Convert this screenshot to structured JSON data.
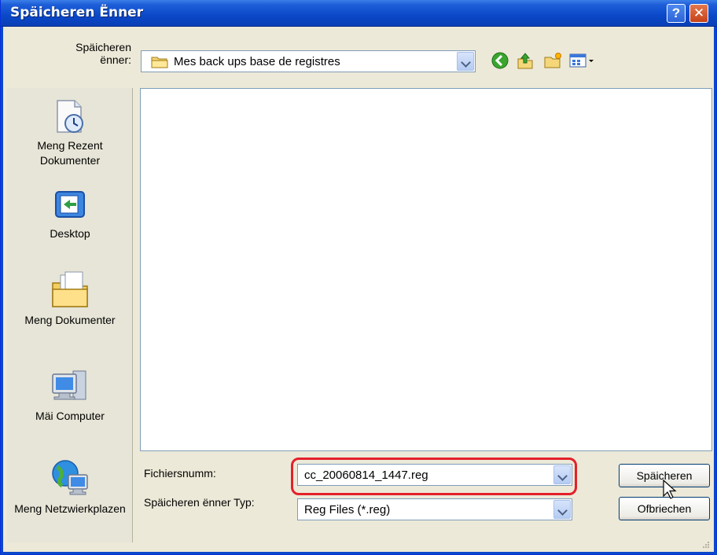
{
  "window": {
    "title": "Späicheren Ënner"
  },
  "titlebar_buttons": {
    "help_label": "?",
    "close_label": "✕"
  },
  "toolbar": {
    "save_in_label": "Späicheren ënner:",
    "save_in_value": "Mes back ups base de registres",
    "icons": [
      "back-icon",
      "up-folder-icon",
      "new-folder-icon",
      "view-menu-icon"
    ]
  },
  "places": [
    {
      "label": "Meng Rezent Dokumenter",
      "icon": "recent-documents-icon"
    },
    {
      "label": "Desktop",
      "icon": "desktop-icon"
    },
    {
      "label": "Meng Dokumenter",
      "icon": "my-documents-icon"
    },
    {
      "label": "Mäi Computer",
      "icon": "my-computer-icon"
    },
    {
      "label": "Meng Netzwierkplazen",
      "icon": "network-places-icon"
    }
  ],
  "file_list": {
    "items": []
  },
  "filename": {
    "label": "Fichiersnumm:",
    "value": "cc_20060814_1447.reg"
  },
  "filetype": {
    "label": "Späicheren ënner Typ:",
    "value": "Reg Files (*.reg)"
  },
  "buttons": {
    "save": "Späicheren",
    "cancel": "Ofbriechen"
  },
  "colors": {
    "titlebar": "#0a48c8",
    "dialog_bg": "#ece9d8",
    "highlight": "#e4202a"
  }
}
